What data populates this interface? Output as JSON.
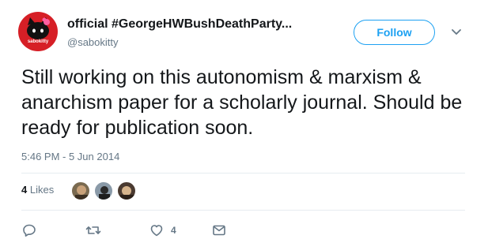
{
  "tweet": {
    "display_name": "official #GeorgeHWBushDeathParty...",
    "username": "@sabokitty",
    "avatar_text": "sabokitty",
    "follow_label": "Follow",
    "text": "Still working on this autonomism & marxism & anarchism paper for a scholarly journal. Should be ready for publication soon.",
    "timestamp": "5:46 PM - 5 Jun 2014",
    "likes_count": "4",
    "likes_label": "Likes",
    "like_action_count": "4"
  },
  "icons": [
    "chevron-down-icon",
    "reply-icon",
    "retweet-icon",
    "heart-icon",
    "message-icon"
  ],
  "colors": {
    "accent": "#1da1f2",
    "muted": "#657786",
    "avatar_bg": "#d61f26"
  }
}
